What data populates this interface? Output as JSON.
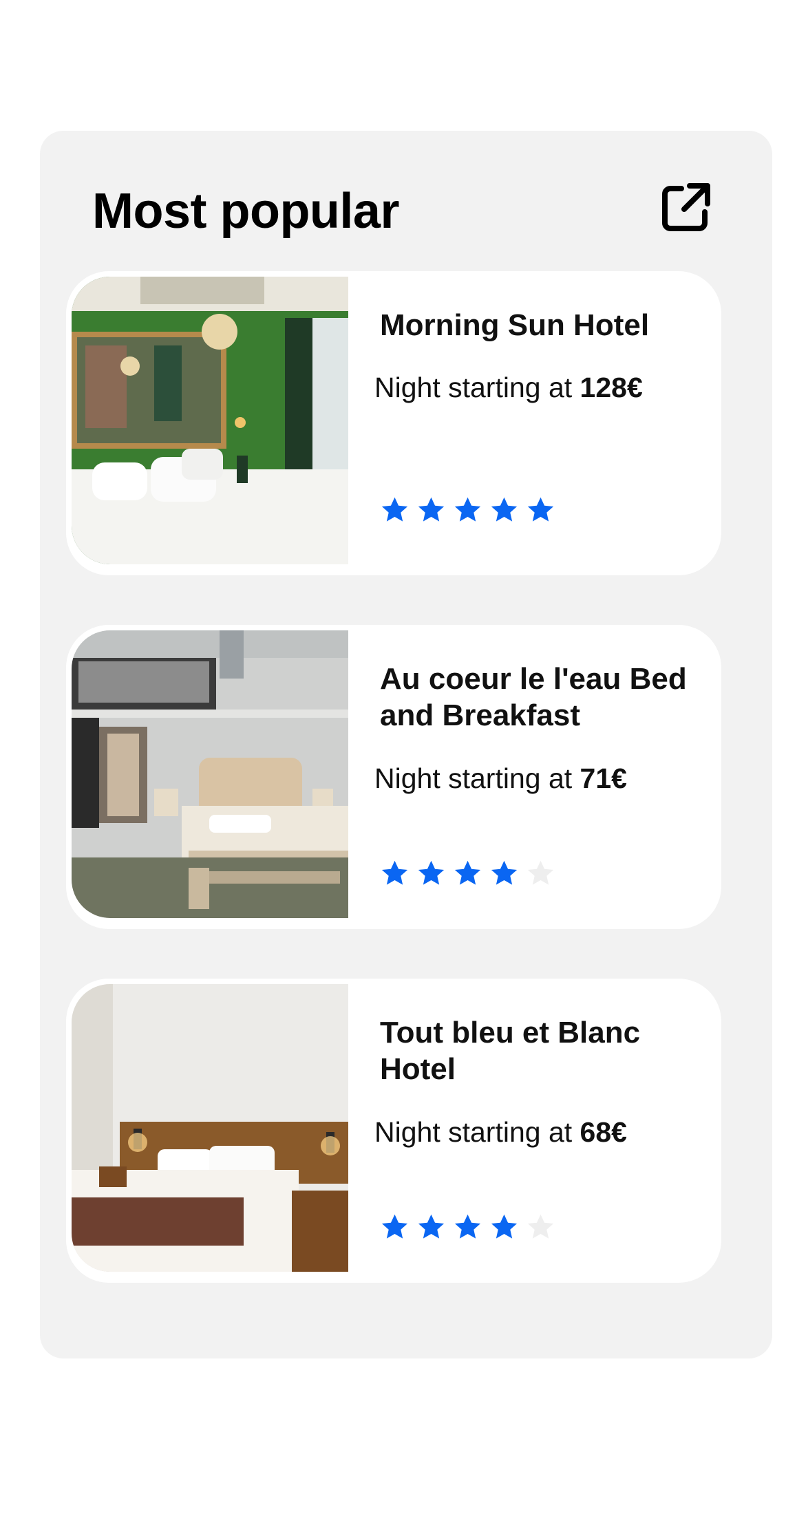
{
  "section": {
    "title": "Most popular",
    "open_icon": "external-link-icon"
  },
  "colors": {
    "panel_bg": "#f2f2f2",
    "card_bg": "#ffffff",
    "star_filled": "#0a66f2",
    "star_empty": "#eeeeee"
  },
  "hotels": [
    {
      "name": "Morning Sun Hotel",
      "price_prefix": "Night starting at",
      "price": "128€",
      "rating": 5,
      "max_rating": 5,
      "image": "hotel-room-green-photo"
    },
    {
      "name": "Au coeur le l'eau Bed and Breakfast",
      "price_prefix": "Night starting at",
      "price": "71€",
      "rating": 4,
      "max_rating": 5,
      "image": "hotel-room-loft-photo"
    },
    {
      "name": "Tout bleu et Blanc Hotel",
      "price_prefix": "Night starting at",
      "price": "68€",
      "rating": 4,
      "max_rating": 5,
      "image": "hotel-room-white-photo"
    }
  ]
}
